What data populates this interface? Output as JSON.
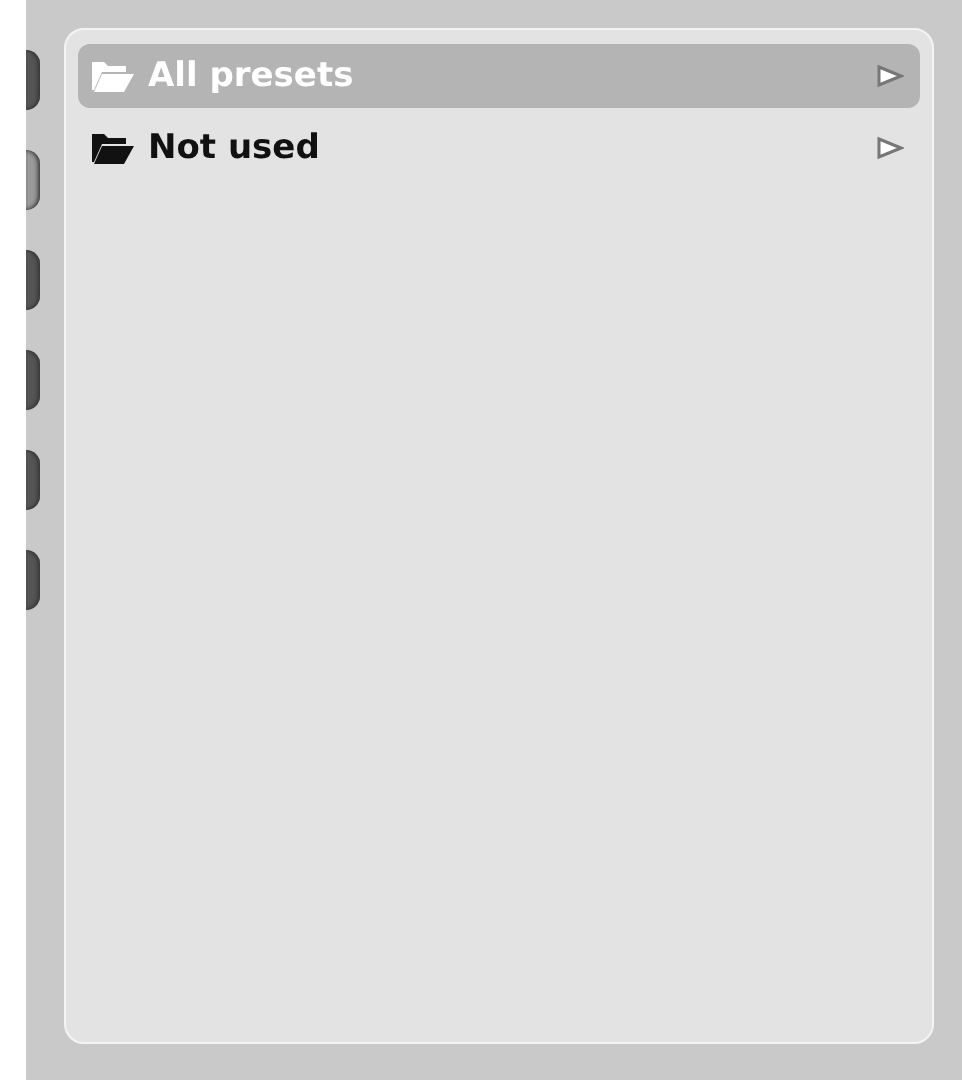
{
  "side_tabs": [
    {
      "selected": false
    },
    {
      "selected": true
    },
    {
      "selected": false
    },
    {
      "selected": false
    },
    {
      "selected": false
    },
    {
      "selected": false
    }
  ],
  "preset_folders": [
    {
      "label": "All presets",
      "selected": true
    },
    {
      "label": "Not used",
      "selected": false
    }
  ]
}
